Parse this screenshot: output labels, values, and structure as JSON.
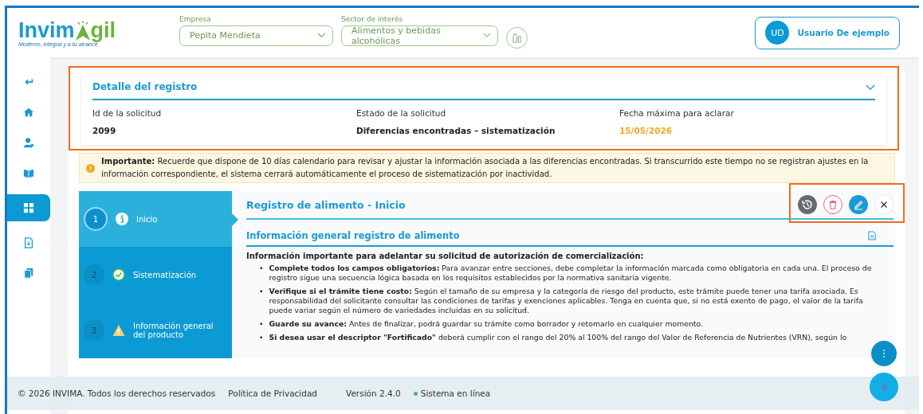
{
  "header": {
    "logo": {
      "name_start": "Invim",
      "name_end": "gil",
      "tagline": "Moderno, integral y a tu alcance"
    },
    "fields": [
      {
        "label": "Empresa",
        "value": "Pepita Mendieta"
      },
      {
        "label": "Sector de interés",
        "value": "Alimentos y bebidas alcohólicas"
      }
    ],
    "user": {
      "initials": "UD",
      "name": "Usuario De ejemplo"
    }
  },
  "sidebar": {
    "items": [
      {
        "kind": "back",
        "selected": false
      },
      {
        "kind": "home",
        "selected": false
      },
      {
        "kind": "user",
        "selected": false
      },
      {
        "kind": "book",
        "selected": false
      },
      {
        "kind": "apps",
        "selected": true
      },
      {
        "kind": "file",
        "selected": false
      },
      {
        "kind": "copy",
        "selected": false
      }
    ]
  },
  "details": {
    "title": "Detalle del registro",
    "expanded": true,
    "highlighted": true,
    "fields": [
      {
        "label": "Id de la solicitud",
        "value": "2099",
        "kind": "plain"
      },
      {
        "label": "Estado de la solicitud",
        "value": "Diferencias encontradas – sistematización",
        "kind": "plain"
      },
      {
        "label": "Fecha máxima para aclarar",
        "value": "15/05/2026",
        "kind": "date"
      }
    ]
  },
  "alert": {
    "text": "**Importante:** Recuerde que dispone de 10 días calendario para revisar y ajustar la información asociada a las diferencias encontradas. Si transcurrido este tiempo no se registran ajustes en la información correspondiente, el sistema cerrará automáticamente el proceso de sistematización por inactividad."
  },
  "steps": [
    {
      "number": "1",
      "label": "Inicio",
      "kind": "info",
      "selected": true
    },
    {
      "number": "2",
      "label": "Sistematización",
      "kind": "done",
      "selected": false
    },
    {
      "number": "3",
      "label": "Información general del producto",
      "kind": "warning",
      "selected": false
    }
  ],
  "panel": {
    "title": "Registro de alimento - Inicio",
    "actions": {
      "highlighted": true,
      "buttons": [
        {
          "kind": "history"
        },
        {
          "kind": "delete"
        },
        {
          "kind": "edit"
        },
        {
          "kind": "close"
        }
      ]
    },
    "section_title": "Información general registro de alimento",
    "intro": "Información importante para adelantar su solicitud de autorización de comercialización:",
    "bullets": [
      {
        "marker": "•",
        "text": "**Complete todos los campos obligatorios:** Para avanzar entre secciones, debe completar la información marcada como obligatoria en cada una. El proceso de registro sigue una secuencia lógica basada en los requisitos establecidos por la normativa sanitaria vigente."
      },
      {
        "marker": "•",
        "text": "**Verifique si el trámite tiene costo:** Según el tamaño de su empresa y la categoría de riesgo del producto, este trámite puede tener una tarifa asociada. Es responsabilidad del solicitante consultar las condiciones de tarifas y exenciones aplicables. Tenga en cuenta que, si no está exento de pago, el valor de la tarifa puede variar según el número de variedades incluidas en su solicitud."
      },
      {
        "marker": "•",
        "text": "**Guarde su avance:** Antes de finalizar, podrá guardar su trámite como borrador y retomarlo en cualquier momento."
      },
      {
        "marker": "•",
        "text": "**Si desea usar el descriptor \"Fortificado\"** deberá cumplir con el rango del 20% al 100% del rango del Valor de Referencia de Nutrientes (VRN), según lo"
      }
    ]
  },
  "footer": {
    "copyright": "© 2026 INVIMA. Todos los derechos reservados",
    "privacy": "Política de Privacidad",
    "version": "Versión 2.4.0",
    "status": "Sistema en línea",
    "online": true
  }
}
